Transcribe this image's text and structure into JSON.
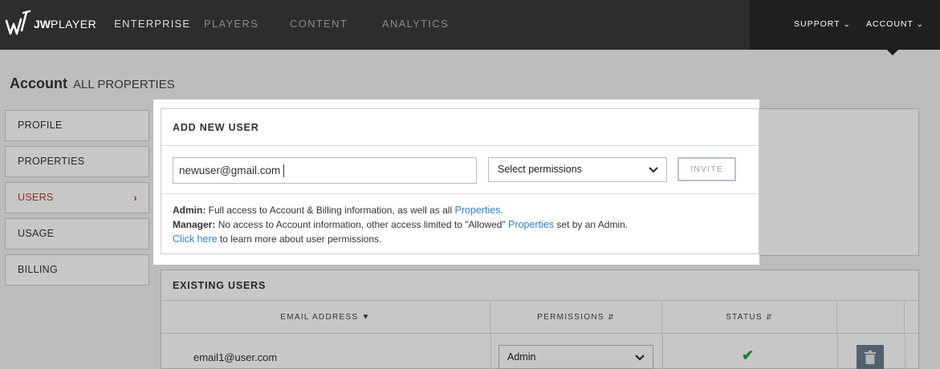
{
  "topnav": {
    "logo_jw": "JW",
    "logo_player": "PLAYER",
    "logo_enterprise": "ENTERPRISE",
    "links": [
      "PLAYERS",
      "CONTENT",
      "ANALYTICS"
    ],
    "support": "SUPPORT",
    "account": "ACCOUNT"
  },
  "page": {
    "title": "Account",
    "subtitle": "ALL PROPERTIES"
  },
  "sidebar": {
    "items": [
      {
        "label": "PROFILE"
      },
      {
        "label": "PROPERTIES"
      },
      {
        "label": "USERS",
        "active": true
      },
      {
        "label": "USAGE"
      },
      {
        "label": "BILLING"
      }
    ]
  },
  "add_user": {
    "title": "ADD NEW USER",
    "email_value": "newuser@gmail.com",
    "permissions_placeholder": "Select permissions",
    "invite_label": "INVITE",
    "admin_label": "Admin:",
    "admin_text": "Full access to Account & Billing information, as well as all",
    "admin_link": "Properties.",
    "manager_label": "Manager:",
    "manager_text": "No access to Account information, other access limited to \"Allowed\"",
    "manager_link": "Properties",
    "manager_text2": "set by an Admin.",
    "click_here": "Click here",
    "learn_more": "to learn more about user permissions."
  },
  "existing_users": {
    "title": "EXISTING USERS",
    "columns": [
      "EMAIL ADDRESS",
      "PERMISSIONS",
      "STATUS"
    ],
    "rows": [
      {
        "email": "email1@user.com",
        "permission": "Admin",
        "status": "active"
      }
    ]
  },
  "colors": {
    "nav_bg": "#2d2d2d",
    "active_red": "#c0392b",
    "link_blue": "#2f7fd1",
    "status_green": "#2e9e3e"
  }
}
